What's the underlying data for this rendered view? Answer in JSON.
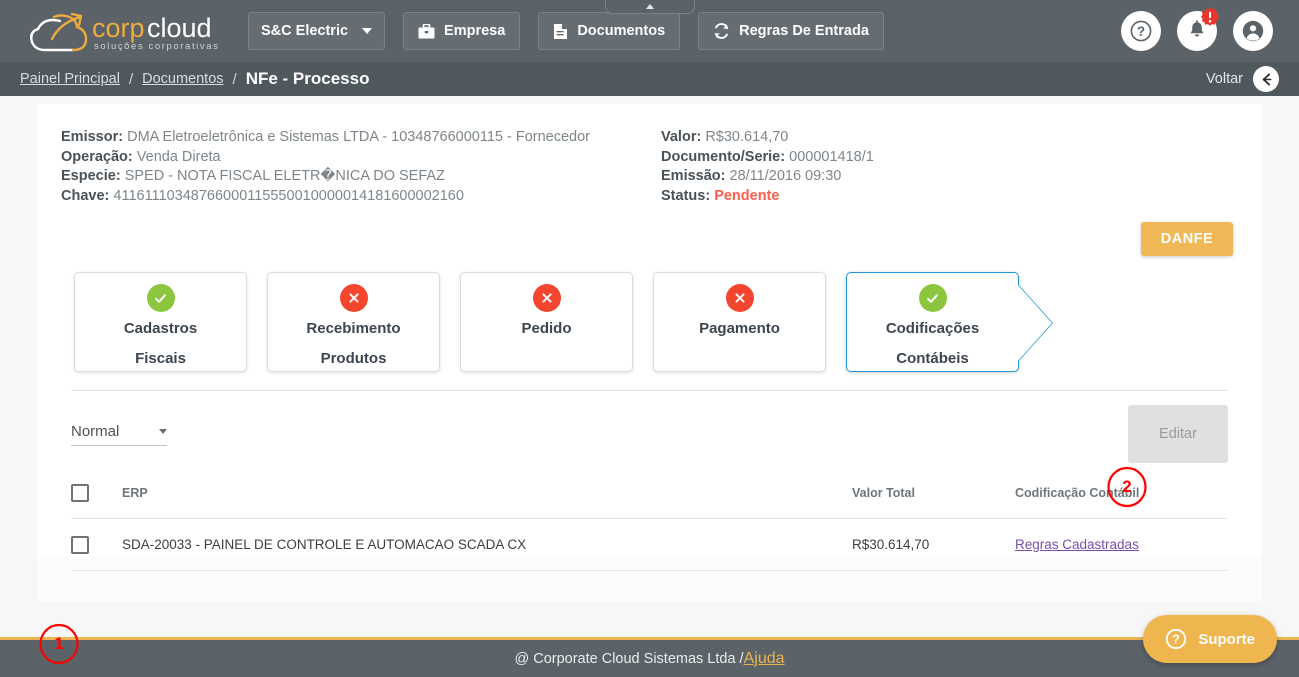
{
  "brand": {
    "name_part1": "corp",
    "name_part2": "cloud",
    "tagline": "soluções corporativas",
    "accent_color": "#eeab3e"
  },
  "topbar": {
    "company_selector": "S&C Electric",
    "nav_buttons": [
      {
        "label": "Empresa",
        "icon": "briefcase-icon"
      },
      {
        "label": "Documentos",
        "icon": "document-icon"
      },
      {
        "label": "Regras De Entrada",
        "icon": "refresh-icon"
      }
    ],
    "icons": [
      {
        "name": "help-icon",
        "glyph": "?"
      },
      {
        "name": "notifications-icon",
        "glyph": "bell",
        "badge": "!"
      },
      {
        "name": "account-icon",
        "glyph": "person"
      }
    ],
    "collapse_toggle": "collapse-menu-icon",
    "background_color": "#5b6368"
  },
  "breadcrumb": {
    "items": [
      {
        "label": "Painel Principal",
        "link": true
      },
      {
        "label": "Documentos",
        "link": true
      },
      {
        "label": "NFe - Processo",
        "link": false
      }
    ],
    "separator": "/",
    "back": {
      "label": "Voltar",
      "icon": "arrow-left-icon"
    }
  },
  "document_info": {
    "left": [
      {
        "label": "Emissor:",
        "value": "DMA Eletroeletrônica e Sistemas LTDA - 10348766000115 - Fornecedor"
      },
      {
        "label": "Operação:",
        "value": "Venda Direta"
      },
      {
        "label": "Especie:",
        "value": "SPED - NOTA FISCAL ELETR�NICA DO SEFAZ"
      },
      {
        "label": "Chave:",
        "value": "41161110348766000115550010000014181600002160"
      }
    ],
    "right": [
      {
        "label": "Valor:",
        "value": "R$30.614,70"
      },
      {
        "label": "Documento/Serie:",
        "value": "000001418/1"
      },
      {
        "label": "Emissão:",
        "value": "28/11/2016 09:30"
      },
      {
        "label": "Status:",
        "value": "Pendente",
        "status_color": "#fd5d4a"
      }
    ]
  },
  "danfe_button": {
    "label": "DANFE",
    "color": "#f0b857"
  },
  "steps": [
    {
      "line1": "Cadastros",
      "line2": "Fiscais",
      "status": "ok",
      "icon": "check-circle-icon",
      "active": false
    },
    {
      "line1": "Recebimento",
      "line2": "Produtos",
      "status": "error",
      "icon": "x-circle-icon",
      "active": false
    },
    {
      "line1": "Pedido",
      "line2": "",
      "status": "error",
      "icon": "x-circle-icon",
      "active": false
    },
    {
      "line1": "Pagamento",
      "line2": "",
      "status": "error",
      "icon": "x-circle-icon",
      "active": false
    },
    {
      "line1": "Codificações",
      "line2": "Contábeis",
      "status": "ok",
      "icon": "check-circle-icon",
      "active": true
    }
  ],
  "status_colors": {
    "ok": "#8cc63e",
    "error": "#f4462e",
    "active_border": "#2196d6"
  },
  "controls": {
    "mode_select": {
      "value": "Normal"
    },
    "edit_button": {
      "label": "Editar",
      "disabled": true
    }
  },
  "table": {
    "columns": [
      "ERP",
      "Valor Total",
      "Codificação Contábil"
    ],
    "rows": [
      {
        "erp": "SDA-20033 - PAINEL DE CONTROLE E AUTOMACAO SCADA CX",
        "valor_total": "R$30.614,70",
        "codificacao": "Regras Cadastradas"
      }
    ]
  },
  "annotations": [
    {
      "id": "1",
      "label": "1",
      "color": "#ff0000"
    },
    {
      "id": "2",
      "label": "2",
      "color": "#ff0000"
    }
  ],
  "footer": {
    "text": "@ Corporate Cloud Sistemas Ltda / ",
    "link": "Ajuda",
    "accent": "#eab54f"
  },
  "support_widget": {
    "label": "Suporte",
    "icon": "help-circle-icon",
    "color": "#efb64f"
  }
}
